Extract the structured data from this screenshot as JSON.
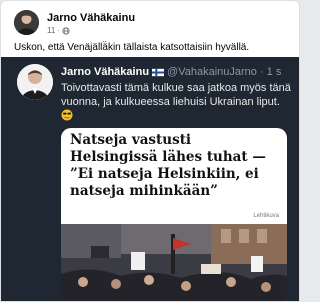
{
  "post": {
    "author": "Jarno Vähäkainu",
    "time": "11",
    "separator": "·",
    "text": "Uskon, että Venäjällä̈kin tällaista katsottaisiin hyvällä."
  },
  "tweet": {
    "name": "Jarno Vähäkainu",
    "handle": "@VahakainuJarno · 1 s",
    "body": "Toivottavasti tämä kulkue saa jatkoa myös tänä vuonna, ja kulkueessa liehuisi Ukrainan liput.",
    "card": {
      "headline": "Natseja vastusti Helsingissä lähes tuhat — ”Ei natseja Helsinkiin, ei natseja mihinkään”",
      "source": "Lehtikuva"
    }
  },
  "icons": {
    "globe": "globe-icon",
    "flag": "finland-flag-icon",
    "emoji": "smiling-face-sunglasses-icon"
  },
  "colors": {
    "embed_bg": "#1e2732",
    "card_bg": "#ffffff"
  }
}
